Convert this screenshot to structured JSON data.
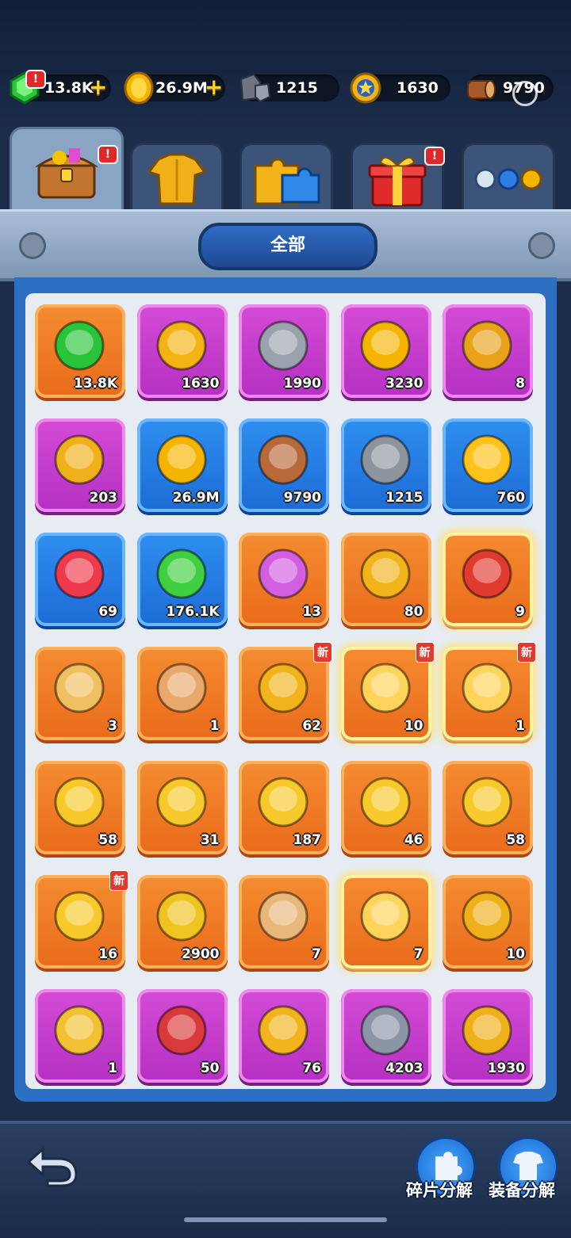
{
  "resources": [
    {
      "name": "gem",
      "value": "13.8K",
      "has_plus": true,
      "has_alert": true
    },
    {
      "name": "gold-coin",
      "value": "26.9M",
      "has_plus": true,
      "has_alert": false
    },
    {
      "name": "iron-ore",
      "value": "1215",
      "has_plus": false,
      "has_alert": false
    },
    {
      "name": "star-medal",
      "value": "1630",
      "has_plus": false,
      "has_alert": false
    },
    {
      "name": "wood-log",
      "value": "9790",
      "has_plus": false,
      "has_alert": false
    }
  ],
  "tabs": [
    {
      "name": "treasure-chest-tab",
      "active": true,
      "alert": true
    },
    {
      "name": "armor-tab",
      "active": false,
      "alert": false
    },
    {
      "name": "puzzle-tab",
      "active": false,
      "alert": false
    },
    {
      "name": "gift-tab",
      "active": false,
      "alert": true
    },
    {
      "name": "orbs-tab",
      "active": false,
      "alert": false
    }
  ],
  "alert_mark": "!",
  "filter": {
    "label": "全部"
  },
  "new_label": "新",
  "items": [
    {
      "icon": "green-gem-icon",
      "bg": "orange",
      "count": "13.8K"
    },
    {
      "icon": "star-badge-icon",
      "bg": "purple",
      "count": "1630"
    },
    {
      "icon": "gears-icon",
      "bg": "purple",
      "count": "1990"
    },
    {
      "icon": "star-coin-icon",
      "bg": "purple",
      "count": "3230"
    },
    {
      "icon": "handshake-token-icon",
      "bg": "purple",
      "count": "8"
    },
    {
      "icon": "winged-medal-icon",
      "bg": "purple",
      "count": "203"
    },
    {
      "icon": "gold-coin-icon",
      "bg": "blue",
      "count": "26.9M"
    },
    {
      "icon": "wood-log-icon",
      "bg": "blue",
      "count": "9790"
    },
    {
      "icon": "iron-ore-icon",
      "bg": "blue",
      "count": "1215"
    },
    {
      "icon": "lightning-icon",
      "bg": "blue",
      "count": "760"
    },
    {
      "icon": "winged-heart-icon",
      "bg": "blue",
      "count": "69"
    },
    {
      "icon": "exp-orb-icon",
      "bg": "blue",
      "count": "176.1K"
    },
    {
      "icon": "purple-scroll-icon",
      "bg": "orange",
      "count": "13"
    },
    {
      "icon": "magnifier-ticket-icon",
      "bg": "orange",
      "count": "80"
    },
    {
      "icon": "red-scroll-icon",
      "bg": "orange",
      "count": "9",
      "glow": true
    },
    {
      "icon": "coin-scroll-icon",
      "bg": "orange",
      "count": "3"
    },
    {
      "icon": "parchment-icon",
      "bg": "orange",
      "count": "1"
    },
    {
      "icon": "puzzle-piece-icon",
      "bg": "orange",
      "count": "62",
      "new": true
    },
    {
      "icon": "golden-puzzle-icon",
      "bg": "orange",
      "count": "10",
      "new": true,
      "glow": true
    },
    {
      "icon": "golden-card-icon",
      "bg": "orange",
      "count": "1",
      "new": true,
      "glow": true
    },
    {
      "icon": "crystal-flower-icon",
      "bg": "orange",
      "count": "58"
    },
    {
      "icon": "crystal-bow-icon",
      "bg": "orange",
      "count": "31"
    },
    {
      "icon": "crystal-shield-icon",
      "bg": "orange",
      "count": "187"
    },
    {
      "icon": "crystal-book-icon",
      "bg": "orange",
      "count": "46"
    },
    {
      "icon": "crystal-sword-icon",
      "bg": "orange",
      "count": "58"
    },
    {
      "icon": "crystal-pile-icon",
      "bg": "orange",
      "count": "16",
      "new": true
    },
    {
      "icon": "green-coin-icon",
      "bg": "orange",
      "count": "2900"
    },
    {
      "icon": "ribbon-scroll-icon",
      "bg": "orange",
      "count": "7"
    },
    {
      "icon": "crown-scroll-icon",
      "bg": "orange",
      "count": "7",
      "glow": true
    },
    {
      "icon": "hammer-icon",
      "bg": "orange",
      "count": "10"
    },
    {
      "icon": "rune-card-icon",
      "bg": "purple",
      "count": "1"
    },
    {
      "icon": "s-scroll-icon",
      "bg": "purple",
      "count": "50"
    },
    {
      "icon": "sword-ticket-icon",
      "bg": "purple",
      "count": "76"
    },
    {
      "icon": "rune-stone-icon",
      "bg": "purple",
      "count": "4203"
    },
    {
      "icon": "guild-banner-icon",
      "bg": "purple",
      "count": "1930"
    }
  ],
  "actions": {
    "fragment_decompose": "碎片分解",
    "equipment_decompose": "装备分解"
  }
}
